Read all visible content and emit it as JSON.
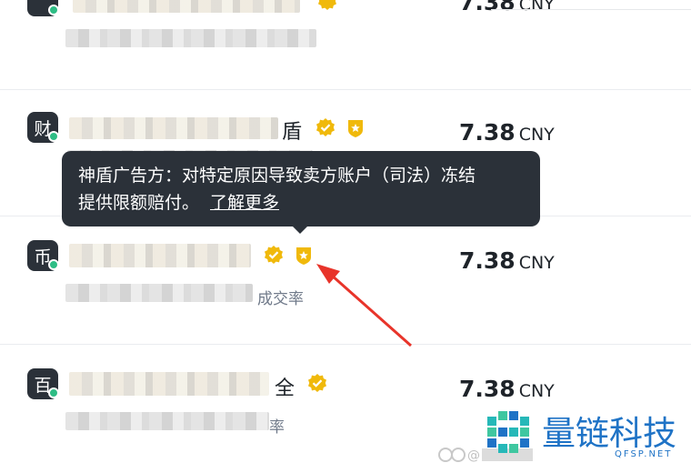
{
  "price_unit": "CNY",
  "ads": [
    {
      "avatar": "",
      "name_tail": "",
      "stats_tail": "",
      "price": "7.38"
    },
    {
      "avatar": "财",
      "name_tail": "盾",
      "stats_tail": "",
      "price": "7.38"
    },
    {
      "avatar": "币",
      "name_tail": "",
      "stats_tail": "成交率",
      "price": "7.38"
    },
    {
      "avatar": "百",
      "name_tail": "全",
      "stats_tail": "率",
      "price": "7.38"
    }
  ],
  "tooltip": {
    "text_line1": "神盾广告方：对特定原因导致卖方账户（司法）冻结",
    "text_line2": "提供限额赔付。",
    "link": "了解更多"
  },
  "watermark": {
    "title": "量链科技",
    "subtitle": "QFSP.NET"
  },
  "colors": {
    "verified": "#f0b90b",
    "shield_badge": "#f0b90b",
    "online": "#2ebd85",
    "arrow": "#e8342a",
    "watermark": "#1f73c6"
  }
}
